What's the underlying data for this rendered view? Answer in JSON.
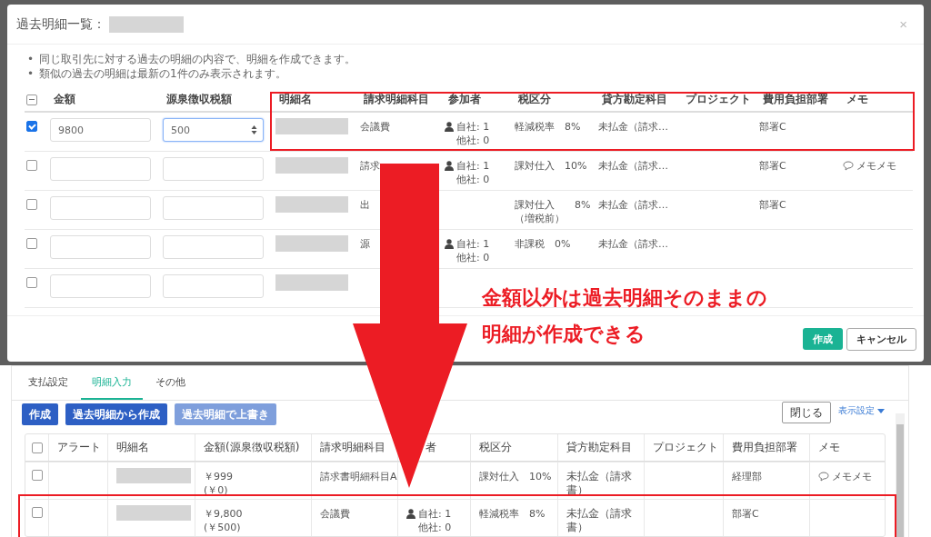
{
  "dialog": {
    "title": "過去明細一覧：",
    "close": "×",
    "notes": [
      {
        "marker": "•",
        "text": "同じ取引先に対する過去の明細の内容で、明細を作成できます。"
      },
      {
        "marker": "•",
        "text": "類似の過去の明細は最新の1件のみ表示されます。"
      }
    ],
    "header_checkbox_mixed": true,
    "columns": [
      "金額",
      "源泉徴収税額",
      "明細名",
      "請求明細科目",
      "参加者",
      "税区分",
      "貸方勘定科目",
      "プロジェクト",
      "費用負担部署",
      "メモ"
    ],
    "rows": [
      {
        "checked": true,
        "amount": "9800",
        "withholding": "500",
        "focused": true,
        "item": "会議費",
        "participants": [
          "自社: 1",
          "他社: 0"
        ],
        "tax": [
          "軽減税率　8%"
        ],
        "credit": "未払金（請求…",
        "dept": "部署C"
      },
      {
        "checked": false,
        "focused": false,
        "item": "請求",
        "participants": [
          "自社: 1",
          "他社: 0"
        ],
        "tax": [
          "課対仕入　10%"
        ],
        "credit": "未払金（請求…",
        "dept": "部署C",
        "memo": "メモメモ"
      },
      {
        "checked": false,
        "focused": false,
        "item": "出",
        "tax": [
          "課対仕入　　8%",
          "（増税前）"
        ],
        "credit": "未払金（請求…",
        "dept": "部署C"
      },
      {
        "checked": false,
        "focused": false,
        "item": "源",
        "participants": [
          "自社: 1",
          "他社: 0"
        ],
        "tax": [
          "非課税　0%"
        ],
        "credit": "未払金（請求…"
      },
      {
        "checked": false,
        "focused": false
      }
    ],
    "buttons": [
      {
        "label": "作成",
        "kind": "primary"
      },
      {
        "label": "キャンセル",
        "kind": "secondary"
      }
    ]
  },
  "annotation": {
    "lines": [
      "金額以外は過去明細そのままの",
      "明細が作成できる"
    ]
  },
  "panel": {
    "tabs": [
      {
        "label": "支払設定",
        "selected": false
      },
      {
        "label": "明細入力",
        "selected": true
      },
      {
        "label": "その他",
        "selected": false
      }
    ],
    "buttons": [
      {
        "label": "作成",
        "disabled": false
      },
      {
        "label": "過去明細から作成",
        "disabled": false
      },
      {
        "label": "過去明細で上書き",
        "disabled": true
      }
    ],
    "close": "閉じる",
    "display_settings": "表示設定",
    "header_checkbox": false,
    "columns": [
      "アラート",
      "明細名",
      "金額(源泉徴収税額)",
      "請求明細科目",
      "者",
      "税区分",
      "貸方勘定科目",
      "プロジェクト",
      "費用負担部署",
      "メモ"
    ],
    "rows": [
      {
        "checked": false,
        "amount": "￥999",
        "withholding": "(￥0)",
        "item": "請求書明細科目A",
        "tax": "課対仕入　10%",
        "credit": "未払金（請求書）",
        "dept": "経理部",
        "memo": "メモメモ"
      },
      {
        "checked": false,
        "amount": "￥9,800",
        "withholding": "(￥500)",
        "item": "会議費",
        "participants": [
          "自社: 1",
          "他社: 0"
        ],
        "tax": "軽減税率　8%",
        "credit": "未払金（請求書）",
        "dept": "部署C"
      }
    ]
  }
}
